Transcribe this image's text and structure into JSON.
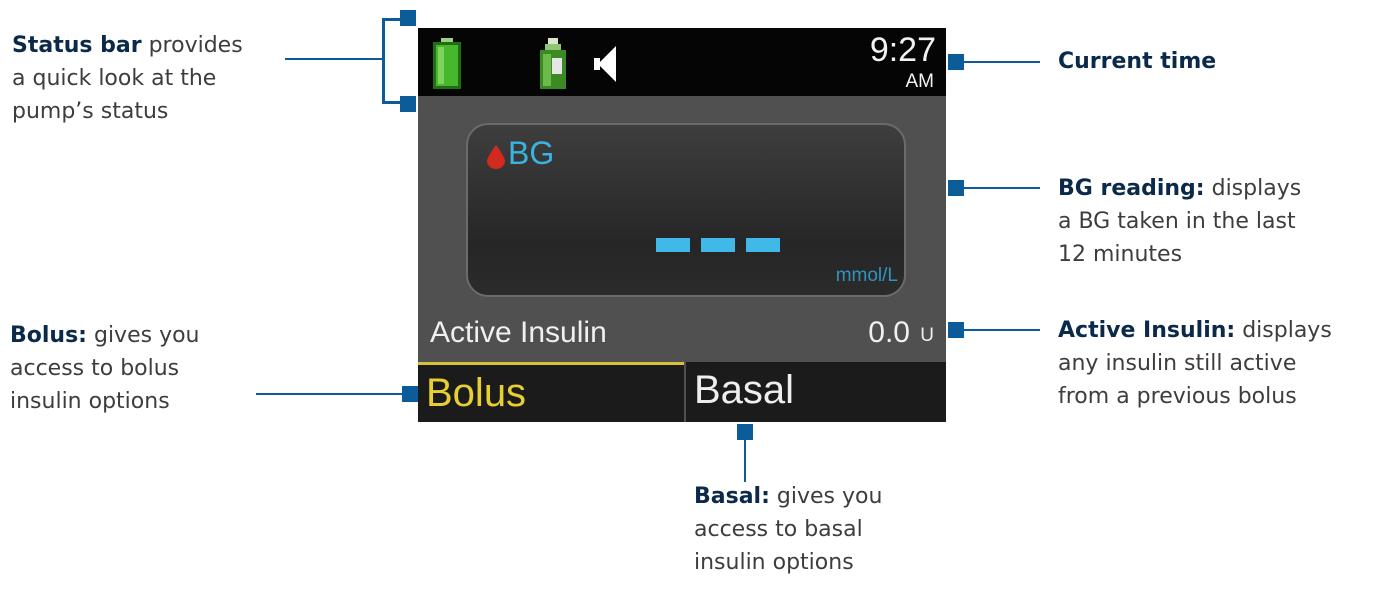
{
  "screen": {
    "time": "9:27",
    "ampm": "AM",
    "bg_label": "BG",
    "bg_unit": "mmol/L",
    "active_insulin_label": "Active Insulin",
    "active_insulin_value": "0.0",
    "active_insulin_unit": "U",
    "bolus_tab": "Bolus",
    "basal_tab": "Basal"
  },
  "callouts": {
    "status_bar": {
      "title": "Status bar",
      "line1": "provides",
      "line2": "a quick look at the",
      "line3": "pump’s status"
    },
    "current_time": {
      "title": "Current time"
    },
    "bg_reading": {
      "title": "BG reading:",
      "line1": "displays",
      "line2": "a BG taken in the last",
      "line3": "12 minutes"
    },
    "bolus": {
      "title": "Bolus:",
      "line1": "gives you",
      "line2": "access to bolus",
      "line3": "insulin options"
    },
    "active_insulin": {
      "title": "Active Insulin:",
      "line1": "displays",
      "line2": "any insulin still active",
      "line3": "from a previous bolus"
    },
    "basal": {
      "title": "Basal:",
      "line1": "gives you",
      "line2": "access to basal",
      "line3": "insulin options"
    }
  },
  "colors": {
    "connector": "#0c5c99",
    "callout_title": "#0b2a4a",
    "bg_text": "#3ab4e0",
    "bolus_text": "#e6cf2e",
    "battery": "#3fae2a"
  }
}
